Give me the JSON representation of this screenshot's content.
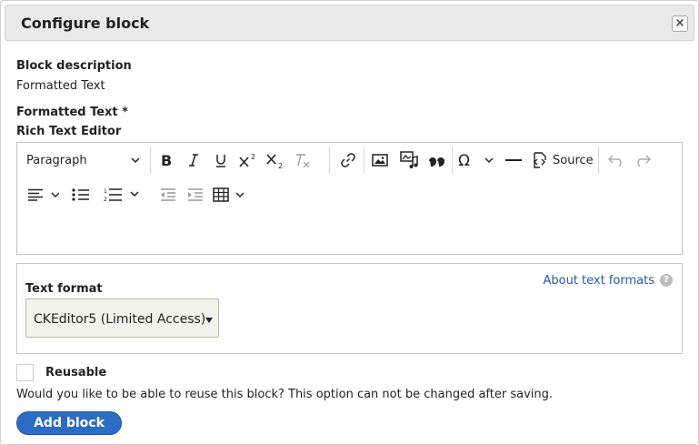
{
  "dialog": {
    "title": "Configure block",
    "close_label": "×"
  },
  "block_description": {
    "label": "Block description",
    "value": "Formatted Text"
  },
  "formatted_text": {
    "label": "Formatted Text *",
    "editor_label": "Rich Text Editor",
    "toolbar": {
      "paragraph_label": "Paragraph",
      "source_label": "Source",
      "icons": [
        "bold-icon",
        "italic-icon",
        "underline-icon",
        "superscript-icon",
        "subscript-icon",
        "remove-format-icon",
        "link-icon",
        "image-icon",
        "media-icon",
        "blockquote-icon",
        "special-characters-icon",
        "horizontal-line-icon",
        "source-icon",
        "undo-icon",
        "redo-icon",
        "align-icon",
        "bulleted-list-icon",
        "numbered-list-icon",
        "outdent-icon",
        "indent-icon",
        "table-icon"
      ]
    },
    "content": ""
  },
  "text_format": {
    "label": "Text format",
    "about_link": "About text formats",
    "help_label": "?",
    "selected": "CKEditor5 (Limited Access)"
  },
  "reusable": {
    "label": "Reusable",
    "checked": false,
    "description": "Would you like to be able to reuse this block? This option can not be changed after saving."
  },
  "actions": {
    "add_block_label": "Add block"
  },
  "colors": {
    "primary": "#2c6cc4",
    "link": "#1e5ba8",
    "titlebar_bg": "#e9e9e9"
  }
}
